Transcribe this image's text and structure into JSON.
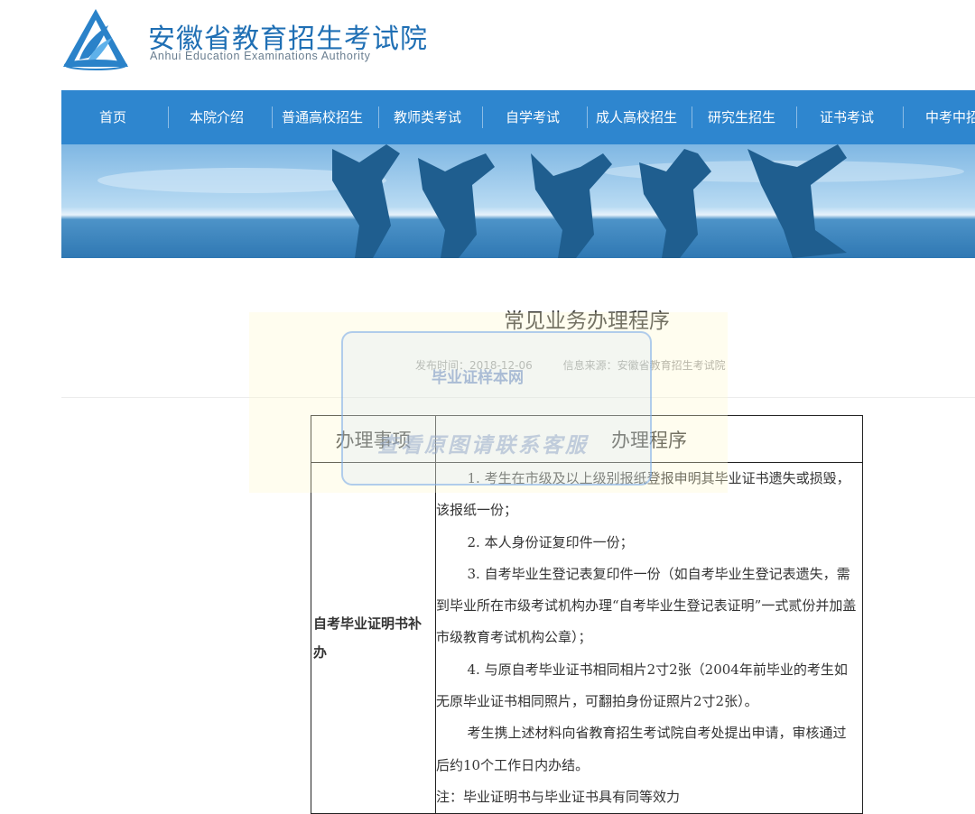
{
  "site": {
    "name": "安徽省教育招生考试院",
    "name_en": "Anhui Education Examinations Authority"
  },
  "nav": {
    "items": [
      "首页",
      "本院介绍",
      "普通高校招生",
      "教师类考试",
      "自学考试",
      "成人高校招生",
      "研究生招生",
      "证书考试",
      "中考中招"
    ]
  },
  "article": {
    "title": "常见业务办理程序",
    "publish_time": "发布时间：2018-12-06",
    "source": "信息来源：安徽省教育招生考试院"
  },
  "watermark": {
    "small": "毕业证样本网",
    "big": "查看原图请联系客服"
  },
  "table": {
    "header_item": "办理事项",
    "header_procedure": "办理程序",
    "rows": [
      {
        "item": "自考毕业证明书补办",
        "paragraphs": [
          "1. 考生在市级及以上级别报纸登报申明其毕业证书遗失或损毁，该报纸一份；",
          "2. 本人身份证复印件一份；",
          "3. 自考毕业生登记表复印件一份（如自考毕业生登记表遗失，需到毕业所在市级考试机构办理“自考毕业生登记表证明”一式贰份并加盖市级教育考试机构公章）；",
          "4. 与原自考毕业证书相同相片2寸2张（2004年前毕业的考生如无原毕业证书相同照片，可翻拍身份证照片2寸2张）。",
          "考生携上述材料向省教育招生考试院自考处提出申请，审核通过后约10个工作日内办结。"
        ],
        "note": "注：毕业证明书与毕业证书具有同等效力"
      }
    ]
  },
  "colors": {
    "brand_blue": "#1f6fb4",
    "nav_blue": "#2e86cf"
  }
}
